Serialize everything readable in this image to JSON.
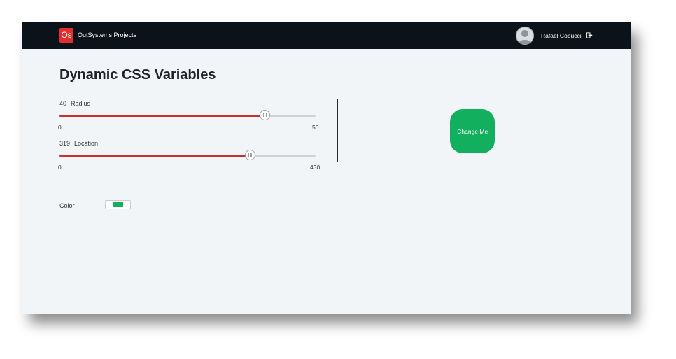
{
  "header": {
    "logo_text": "Os",
    "app_title": "OutSystems Projects",
    "user_name": "Rafael Cobucci"
  },
  "page": {
    "title": "Dynamic CSS Variables"
  },
  "sliders": [
    {
      "value": "40",
      "label": "Radius",
      "min": "0",
      "max": "50"
    },
    {
      "value": "319",
      "label": "Location",
      "min": "0",
      "max": "430"
    }
  ],
  "color": {
    "label": "Color",
    "value": "#12b05e"
  },
  "preview": {
    "button_label": "Change Me"
  },
  "colors": {
    "header_bg": "#0b121a",
    "accent": "#c7312b",
    "logo_bg": "#e62d2d",
    "button_bg": "#12b05e"
  }
}
